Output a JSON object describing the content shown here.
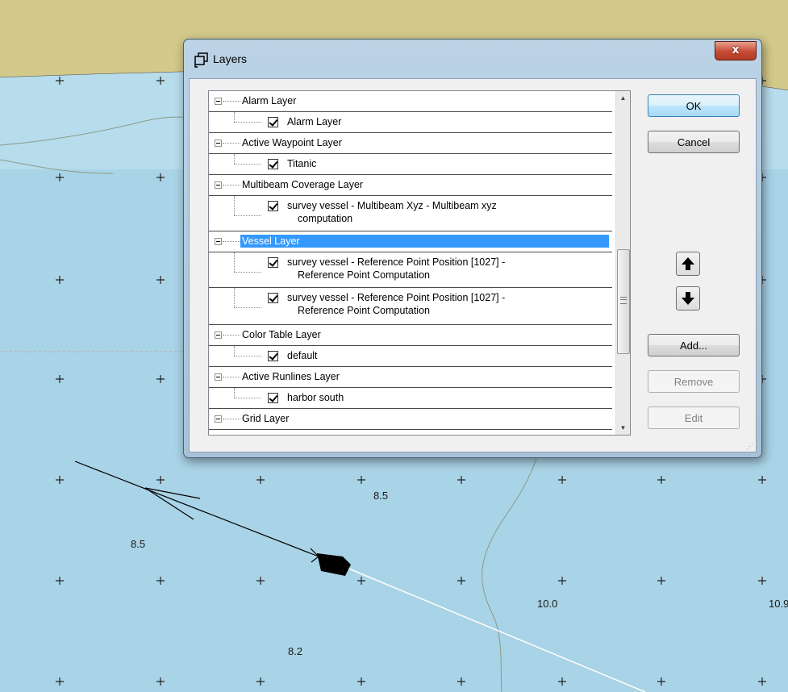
{
  "dialog": {
    "title": "Layers",
    "close_label": "x"
  },
  "tree": {
    "rows": [
      {
        "label": "Alarm Layer",
        "level": 0
      },
      {
        "label": "Alarm Layer",
        "level": 1,
        "checked": true
      },
      {
        "label": "Active Waypoint Layer",
        "level": 0
      },
      {
        "label": "Titanic",
        "level": 1,
        "checked": true
      },
      {
        "label": "Multibeam Coverage Layer",
        "level": 0
      },
      {
        "label": "survey vessel - Multibeam Xyz - Multibeam xyz",
        "label2": "computation",
        "level": 1,
        "checked": true
      },
      {
        "label": "Vessel Layer",
        "level": 0,
        "selected": true
      },
      {
        "label": "survey vessel - Reference Point Position [1027] -",
        "label2": "Reference Point Computation",
        "level": 1,
        "checked": true
      },
      {
        "label": "survey vessel - Reference Point Position [1027] -",
        "label2": "Reference Point Computation",
        "level": 1,
        "checked": true
      },
      {
        "label": "Color Table Layer",
        "level": 0
      },
      {
        "label": "default",
        "level": 1,
        "checked": true
      },
      {
        "label": "Active Runlines Layer",
        "level": 0
      },
      {
        "label": "harbor south",
        "level": 1,
        "checked": true
      },
      {
        "label": "Grid Layer",
        "level": 0
      }
    ]
  },
  "buttons": {
    "ok": "OK",
    "cancel": "Cancel",
    "add": "Add...",
    "remove": "Remove",
    "edit": "Edit"
  },
  "map": {
    "soundings": [
      "8.5",
      "8.5",
      "10.0",
      "10.9",
      "8.2"
    ],
    "colors": {
      "land": "#d2c98a",
      "water_shallow": "#a9d3e6",
      "water_deep": "#b7dcec"
    }
  }
}
